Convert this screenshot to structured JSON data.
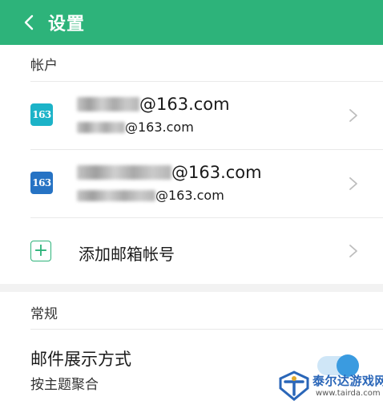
{
  "header": {
    "title": "设置",
    "background": "#2db37a"
  },
  "accounts_section": {
    "label": "帐户",
    "accounts": [
      {
        "badge": "163",
        "badge_color": "#1cb3c8",
        "email_main_suffix": "@163.com",
        "email_sub_suffix": "@163.com"
      },
      {
        "badge": "163",
        "badge_color": "#2673c4",
        "email_main_suffix": "@163.com",
        "email_sub_suffix": "@163.com"
      }
    ],
    "add_account_label": "添加邮箱帐号"
  },
  "general_section": {
    "label": "常规",
    "mail_display": {
      "title": "邮件展示方式",
      "value": "按主题聚合"
    }
  },
  "watermark": {
    "name": "泰尔达游戏网",
    "url": "www.tairda.com"
  }
}
